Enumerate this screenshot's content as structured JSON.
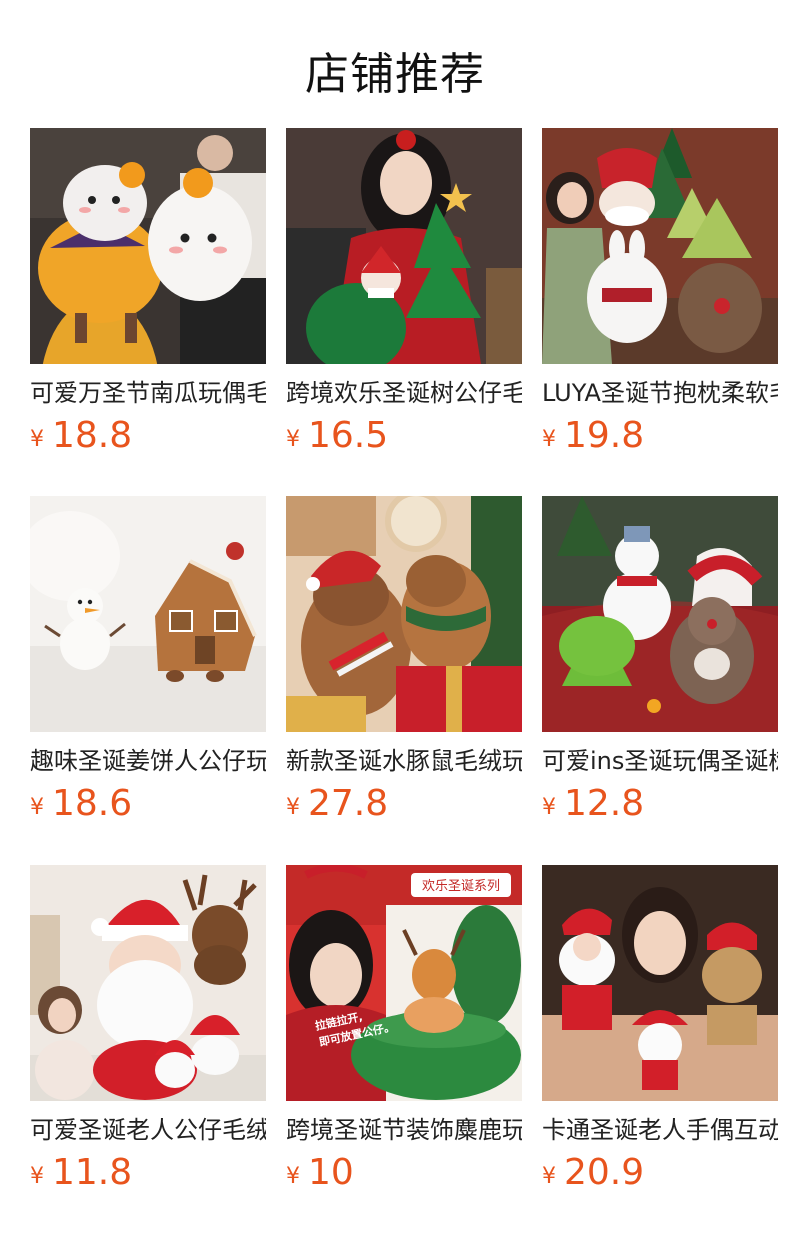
{
  "page_title": "店铺推荐",
  "currency_symbol": "¥",
  "accent_color": "#e8541d",
  "products": [
    {
      "name": "可爱万圣节南瓜玩偶毛绒",
      "price": "18.8"
    },
    {
      "name": "跨境欢乐圣诞树公仔毛绒",
      "price": "16.5"
    },
    {
      "name": "LUYA圣诞节抱枕柔软毛绒",
      "price": "19.8"
    },
    {
      "name": "趣味圣诞姜饼人公仔玩偶",
      "price": "18.6"
    },
    {
      "name": "新款圣诞水豚鼠毛绒玩具",
      "price": "27.8"
    },
    {
      "name": "可爱ins圣诞玩偶圣诞树",
      "price": "12.8"
    },
    {
      "name": "可爱圣诞老人公仔毛绒玩",
      "price": "11.8"
    },
    {
      "name": "跨境圣诞节装饰麋鹿玩偶",
      "price": "10"
    },
    {
      "name": "卡通圣诞老人手偶互动",
      "price": "20.9"
    }
  ],
  "image_captions": {
    "banner_tag": "欢乐圣诞系列",
    "overlay_line1": "拉链拉开,",
    "overlay_line2": "即可放置公仔。"
  }
}
